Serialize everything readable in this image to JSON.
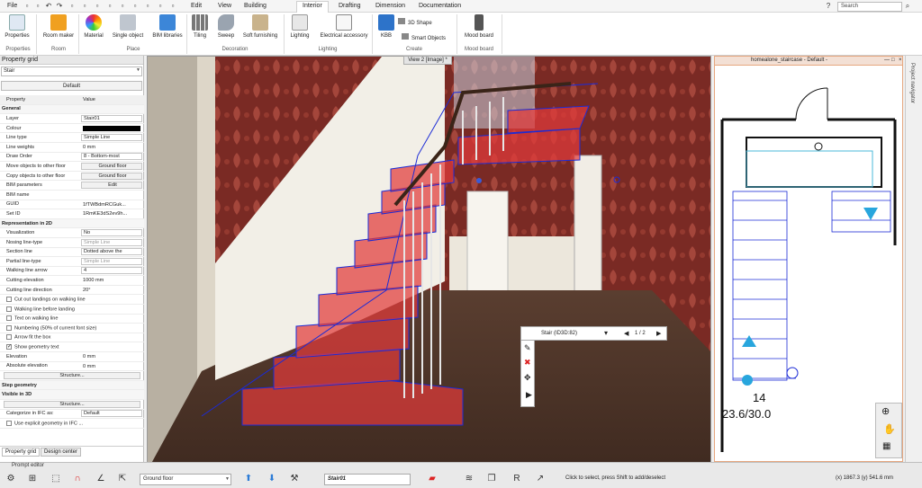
{
  "menu": [
    "File",
    "Edit",
    "View",
    "Building",
    "Interior",
    "Drafting",
    "Dimension",
    "Documentation"
  ],
  "menu_active": "Interior",
  "search": {
    "placeholder": "Search"
  },
  "ribbon": {
    "buttons": [
      "Properties",
      "Room maker",
      "Material",
      "Single object",
      "BIM libraries",
      "Tiling",
      "Sweep",
      "Soft furnishing",
      "Lighting",
      "Electrical accessory",
      "KBB",
      "3D Shape",
      "Smart Objects",
      "Mood board"
    ],
    "groups": [
      "Properties",
      "Room",
      "Place",
      "Decoration",
      "Lighting",
      "Create",
      "Mood board"
    ]
  },
  "property_grid": {
    "title": "Property grid",
    "selector": "Stair",
    "default_button": "Default",
    "header": {
      "property": "Property",
      "value": "Value"
    },
    "sections": {
      "general": "General",
      "rep2d": "Representation in 2D",
      "step": "Step geometry",
      "vis3d": "Visible in 3D"
    },
    "general": [
      {
        "k": "Layer",
        "v": "Stair01"
      },
      {
        "k": "Colour",
        "v": ""
      },
      {
        "k": "Line type",
        "v": "Simple Line"
      },
      {
        "k": "Line weights",
        "v": "0 mm"
      },
      {
        "k": "Draw Order",
        "v": "8 - Bottom-most"
      },
      {
        "k": "Move objects to other floor",
        "v": "Ground floor"
      },
      {
        "k": "Copy objects to other floor",
        "v": "Ground floor"
      },
      {
        "k": "BIM parameters",
        "v": "Edit"
      },
      {
        "k": "BIM name",
        "v": ""
      },
      {
        "k": "GUID",
        "v": "1fTWBdmRCGuk..."
      },
      {
        "k": "Set ID",
        "v": "1RmKE3dS2ev9h..."
      }
    ],
    "rep2d": [
      {
        "k": "Visualization",
        "v": "No"
      },
      {
        "k": "Nosing line-type",
        "v": "Simple Line"
      },
      {
        "k": "Section line",
        "v": "Dotted above the"
      },
      {
        "k": "Partial line-type",
        "v": "Simple Line"
      },
      {
        "k": "Walking line arrow",
        "v": "4"
      },
      {
        "k": "Cutting elevation",
        "v": "1000 mm"
      },
      {
        "k": "Cutting line direction",
        "v": "20°"
      }
    ],
    "checks": [
      {
        "k": "Cut out landings on walking line",
        "on": false
      },
      {
        "k": "Walking line before landing",
        "on": false
      },
      {
        "k": "Text on walking line",
        "on": false
      },
      {
        "k": "Numbering (50% of current font size)",
        "on": false
      },
      {
        "k": "Arrow fit the box",
        "on": false
      },
      {
        "k": "Show geometry text",
        "on": true
      }
    ],
    "rep2d_tail": [
      {
        "k": "Elevation",
        "v": "0 mm"
      },
      {
        "k": "Absolute elevation",
        "v": "0 mm"
      }
    ],
    "structure_label": "Structure...",
    "vis3d_structure": "Structure...",
    "ifc": {
      "k": "Categorize in IFC as:",
      "v": "Default"
    },
    "explicit": "Use explicit geometry in IFC ...",
    "tabs": [
      "Property grid",
      "Design center"
    ]
  },
  "viewport3d": {
    "tab": "View 2 [Image] *",
    "popup_title": "Stair (ID3D:82)",
    "popup_page": "1 / 2"
  },
  "viewport2d": {
    "title": "homealone_staircase - Default -",
    "step_count": "14",
    "step_ratio": "23.6/30.0"
  },
  "navigator": {
    "label": "Project navigator"
  },
  "bottom": {
    "prompt": "Prompt editor",
    "floor": "Ground floor",
    "layer": "Stair01",
    "status": "Click to select, press Shift to add/deselect",
    "coords": "(x) 1867.3   (y) 541.6 mm"
  },
  "colors": {
    "stair": "#e03a3a",
    "accent": "#2b7bd6",
    "wallpaper": "#7a2a24"
  }
}
